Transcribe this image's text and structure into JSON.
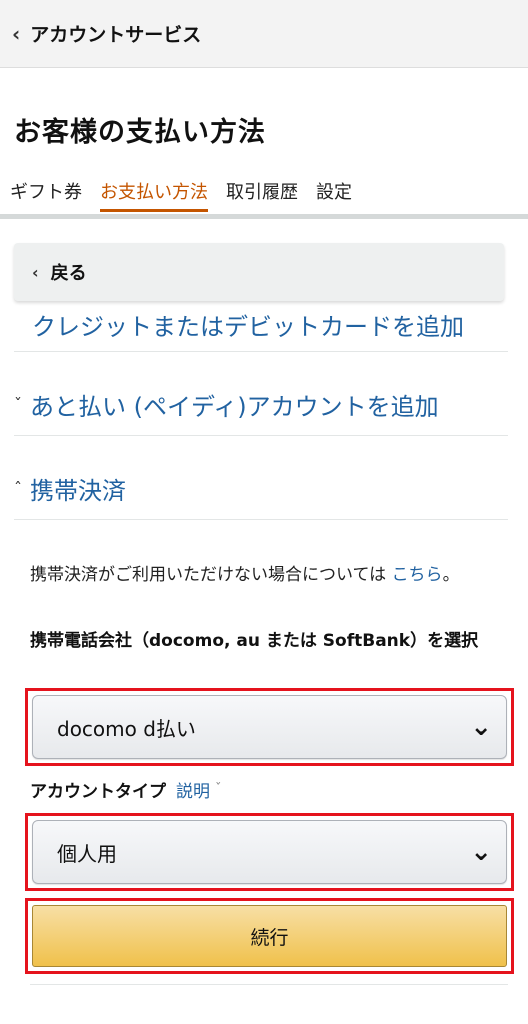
{
  "header": {
    "back_icon": "chevron-left-icon",
    "title": "アカウントサービス"
  },
  "page": {
    "title": "お客様の支払い方法"
  },
  "tabs": [
    {
      "label": "ギフト券",
      "active": false
    },
    {
      "label": "お支払い方法",
      "active": true
    },
    {
      "label": "取引履歴",
      "active": false
    },
    {
      "label": "設定",
      "active": false
    }
  ],
  "back": {
    "label": "戻る"
  },
  "sections": [
    {
      "label": "クレジットまたはデビットカードを追加",
      "icon": ""
    },
    {
      "label": "あと払い (ペイディ)アカウントを追加",
      "icon": "chevron-down-icon"
    },
    {
      "label": "携帯決済",
      "icon": "chevron-up-icon"
    }
  ],
  "mobile_payment": {
    "info_text": "携帯決済がご利用いただけない場合については",
    "info_link": "こちら",
    "info_suffix": "。",
    "carrier_label": "携帯電話会社（docomo, au または SoftBank）を選択",
    "carrier_value": "docomo d払い",
    "account_type_label": "アカウントタイプ",
    "explanation_link": "説明",
    "account_type_value": "個人用",
    "continue_label": "続行"
  },
  "colors": {
    "link": "#2162a1",
    "active_tab": "#c45500",
    "highlight_border": "#e5131d",
    "button_yellow": "#f0c14b"
  }
}
